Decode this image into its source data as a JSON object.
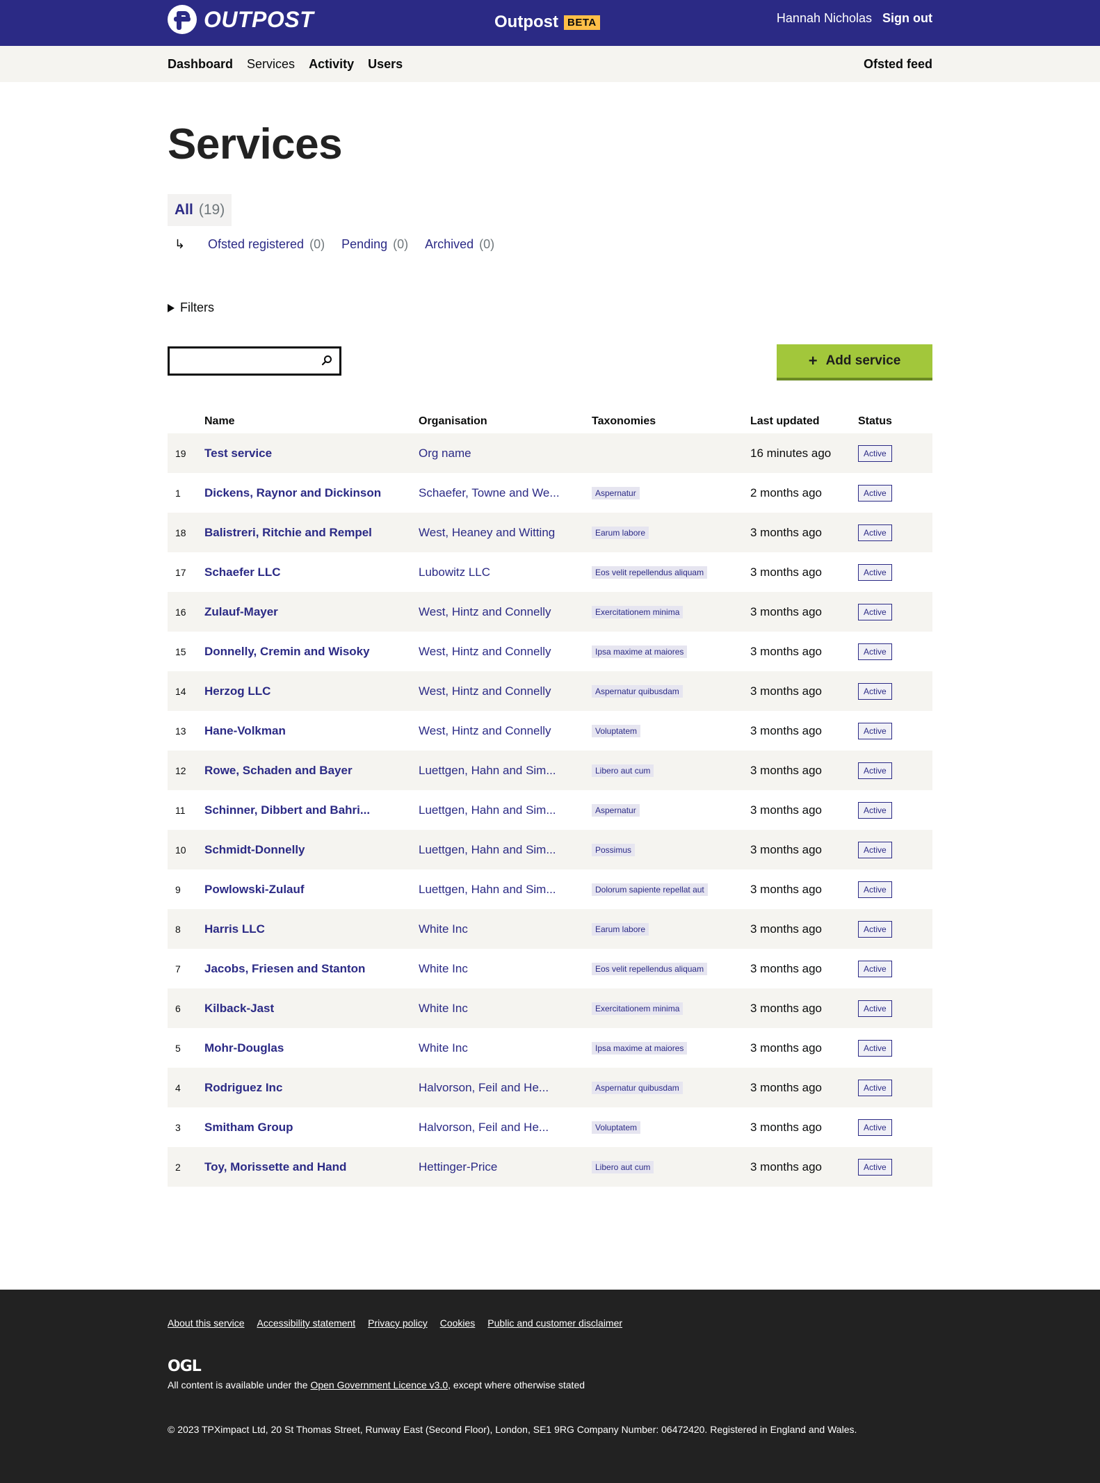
{
  "header": {
    "logo_text": "OUTPOST",
    "app_name": "Outpost",
    "beta_label": "BETA",
    "user_name": "Hannah Nicholas",
    "sign_out_label": "Sign out"
  },
  "nav": {
    "items": [
      "Dashboard",
      "Services",
      "Activity",
      "Users"
    ],
    "current": "Services",
    "right_link": "Ofsted feed"
  },
  "page": {
    "title": "Services",
    "filter_all": {
      "label": "All",
      "count": "(19)"
    },
    "filter_sub": [
      {
        "label": "Ofsted registered",
        "count": "(0)"
      },
      {
        "label": "Pending",
        "count": "(0)"
      },
      {
        "label": "Archived",
        "count": "(0)"
      }
    ],
    "filters_label": "Filters",
    "search": {
      "value": "",
      "placeholder": ""
    },
    "add_button_label": "Add service"
  },
  "table": {
    "headers": [
      "",
      "Name",
      "Organisation",
      "Taxonomies",
      "Last updated",
      "Status"
    ],
    "rows": [
      {
        "id": "19",
        "name": "Test service",
        "org": "Org name",
        "tax": "",
        "updated": "16 minutes ago",
        "status": "Active"
      },
      {
        "id": "1",
        "name": "Dickens, Raynor and Dickinson",
        "org": "Schaefer, Towne and We...",
        "tax": "Aspernatur",
        "updated": "2 months ago",
        "status": "Active"
      },
      {
        "id": "18",
        "name": "Balistreri, Ritchie and Rempel",
        "org": "West, Heaney and Witting",
        "tax": "Earum labore",
        "updated": "3 months ago",
        "status": "Active"
      },
      {
        "id": "17",
        "name": "Schaefer LLC",
        "org": "Lubowitz LLC",
        "tax": "Eos velit repellendus aliquam",
        "updated": "3 months ago",
        "status": "Active"
      },
      {
        "id": "16",
        "name": "Zulauf-Mayer",
        "org": "West, Hintz and Connelly",
        "tax": "Exercitationem minima",
        "updated": "3 months ago",
        "status": "Active"
      },
      {
        "id": "15",
        "name": "Donnelly, Cremin and Wisoky",
        "org": "West, Hintz and Connelly",
        "tax": "Ipsa maxime at maiores",
        "updated": "3 months ago",
        "status": "Active"
      },
      {
        "id": "14",
        "name": "Herzog LLC",
        "org": "West, Hintz and Connelly",
        "tax": "Aspernatur quibusdam",
        "updated": "3 months ago",
        "status": "Active"
      },
      {
        "id": "13",
        "name": "Hane-Volkman",
        "org": "West, Hintz and Connelly",
        "tax": "Voluptatem",
        "updated": "3 months ago",
        "status": "Active"
      },
      {
        "id": "12",
        "name": "Rowe, Schaden and Bayer",
        "org": "Luettgen, Hahn and Sim...",
        "tax": "Libero aut cum",
        "updated": "3 months ago",
        "status": "Active"
      },
      {
        "id": "11",
        "name": "Schinner, Dibbert and Bahri...",
        "org": "Luettgen, Hahn and Sim...",
        "tax": "Aspernatur",
        "updated": "3 months ago",
        "status": "Active"
      },
      {
        "id": "10",
        "name": "Schmidt-Donnelly",
        "org": "Luettgen, Hahn and Sim...",
        "tax": "Possimus",
        "updated": "3 months ago",
        "status": "Active"
      },
      {
        "id": "9",
        "name": "Powlowski-Zulauf",
        "org": "Luettgen, Hahn and Sim...",
        "tax": "Dolorum sapiente repellat aut",
        "updated": "3 months ago",
        "status": "Active"
      },
      {
        "id": "8",
        "name": "Harris LLC",
        "org": "White Inc",
        "tax": "Earum labore",
        "updated": "3 months ago",
        "status": "Active"
      },
      {
        "id": "7",
        "name": "Jacobs, Friesen and Stanton",
        "org": "White Inc",
        "tax": "Eos velit repellendus aliquam",
        "updated": "3 months ago",
        "status": "Active"
      },
      {
        "id": "6",
        "name": "Kilback-Jast",
        "org": "White Inc",
        "tax": "Exercitationem minima",
        "updated": "3 months ago",
        "status": "Active"
      },
      {
        "id": "5",
        "name": "Mohr-Douglas",
        "org": "White Inc",
        "tax": "Ipsa maxime at maiores",
        "updated": "3 months ago",
        "status": "Active"
      },
      {
        "id": "4",
        "name": "Rodriguez Inc",
        "org": "Halvorson, Feil and He...",
        "tax": "Aspernatur quibusdam",
        "updated": "3 months ago",
        "status": "Active"
      },
      {
        "id": "3",
        "name": "Smitham Group",
        "org": "Halvorson, Feil and He...",
        "tax": "Voluptatem",
        "updated": "3 months ago",
        "status": "Active"
      },
      {
        "id": "2",
        "name": "Toy, Morissette and Hand",
        "org": "Hettinger-Price",
        "tax": "Libero aut cum",
        "updated": "3 months ago",
        "status": "Active"
      }
    ]
  },
  "footer": {
    "links": [
      "About this service",
      "Accessibility statement",
      "Privacy policy",
      "Cookies",
      "Public and customer disclaimer"
    ],
    "ogl_logo": "OGL",
    "licence_prefix": "All content is available under the ",
    "licence_link": "Open Government Licence v3.0",
    "licence_suffix": ", except where otherwise stated",
    "copyright": "© 2023 TPXimpact Ltd, 20 St Thomas Street, Runway East (Second Floor), London, SE1 9RG Company Number: 06472420. Registered in England and Wales."
  },
  "colors": {
    "brand": "#2b2a85",
    "beta": "#ffbf47",
    "add_button": "#a2c73b",
    "subnav_bg": "#f5f4f0",
    "footer_bg": "#222222"
  },
  "icons": {
    "logo": "outpost-logo-icon",
    "search": "search-icon",
    "plus": "plus-icon",
    "filters": "triangle-right-icon",
    "sub_arrow": "return-arrow-icon"
  }
}
